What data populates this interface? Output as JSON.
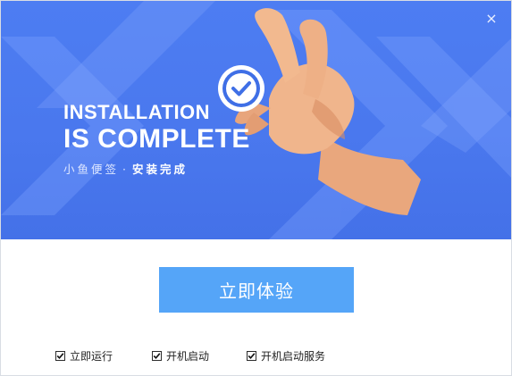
{
  "window": {
    "close_glyph": "×",
    "close_icon": "close-icon"
  },
  "banner": {
    "title_line1": "INSTALLATION",
    "title_line2": "IS COMPLETE",
    "subtitle_app": "小鱼便签",
    "subtitle_sep": "·",
    "subtitle_status": "安装完成",
    "badge_icon": "check-circle-icon",
    "illustration": "hand-holding-check-badge",
    "colors": {
      "background": "#4d7df2",
      "shape_light": "#6b97ff",
      "badge_ring": "#ffffff",
      "badge_fill": "#3f6fe6"
    }
  },
  "main": {
    "primary_button_label": "立即体验",
    "primary_button_color": "#55a5f8"
  },
  "options": [
    {
      "label": "立即运行",
      "checked": true
    },
    {
      "label": "开机启动",
      "checked": true
    },
    {
      "label": "开机启动服务",
      "checked": true
    }
  ]
}
